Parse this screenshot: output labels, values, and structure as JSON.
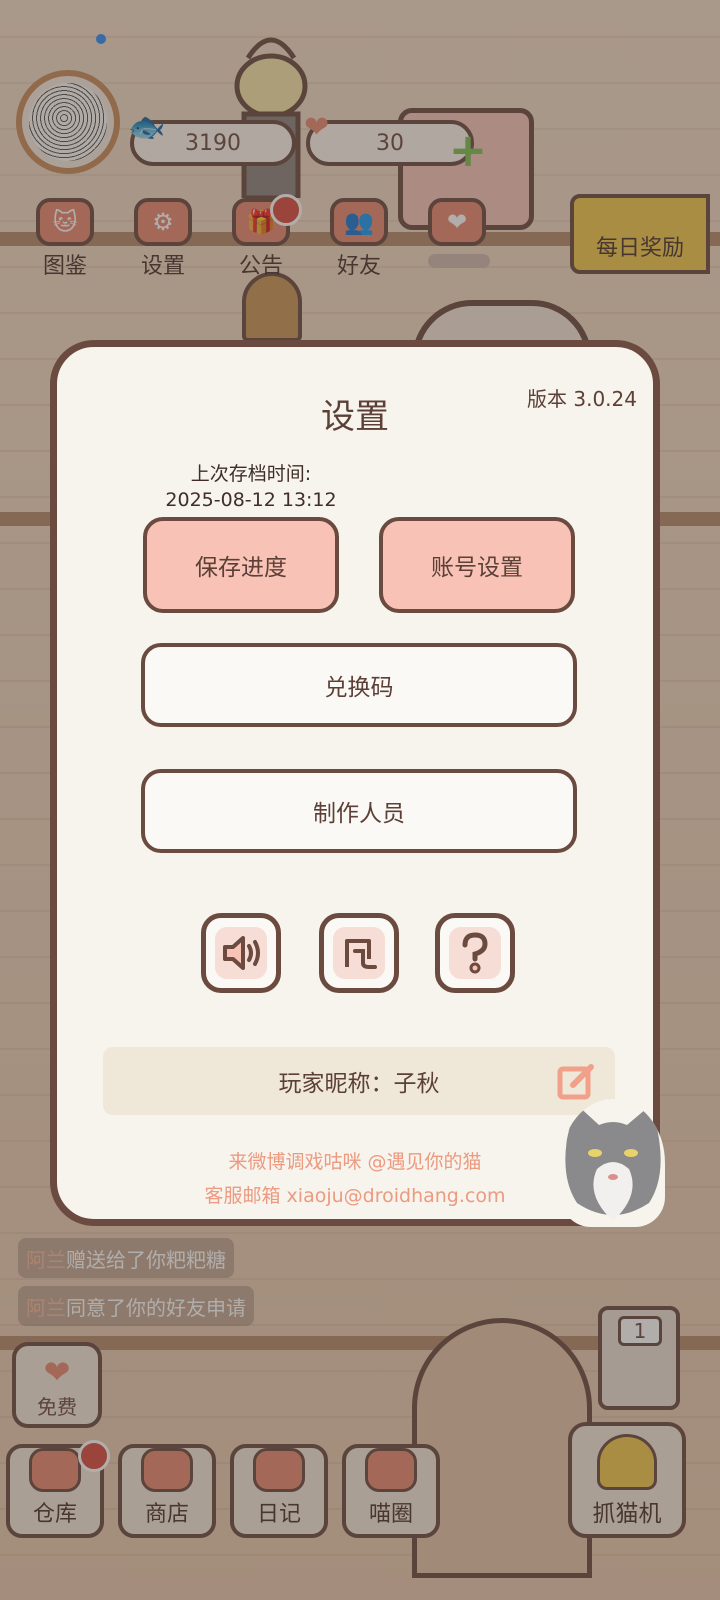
{
  "topbar": {
    "fish_count": "3190",
    "heart_count": "30"
  },
  "nav": [
    {
      "label": "图鉴",
      "icon": "cat-book-icon"
    },
    {
      "label": "设置",
      "icon": "gear-icon"
    },
    {
      "label": "公告",
      "icon": "gift-icon"
    },
    {
      "label": "好友",
      "icon": "friends-icon"
    },
    {
      "label": "",
      "icon": "heart-pair-icon"
    }
  ],
  "daily_reward": "每日奖励",
  "chat": [
    {
      "who": "阿兰",
      "text": "赠送给了你粑粑糖"
    },
    {
      "who": "阿兰",
      "text": "同意了你的好友申请"
    }
  ],
  "free_label": "免费",
  "bottom_menu": [
    {
      "label": "仓库"
    },
    {
      "label": "商店"
    },
    {
      "label": "日记"
    },
    {
      "label": "喵圈"
    }
  ],
  "claw_machine": {
    "label": "抓猫机",
    "count": "1"
  },
  "modal": {
    "title": "设置",
    "version": "版本 3.0.24",
    "save_time_label": "上次存档时间:",
    "save_time_value": "2025-08-12 13:12",
    "save_button": "保存进度",
    "account_button": "账号设置",
    "redeem_button": "兑换码",
    "credits_button": "制作人员",
    "icon_buttons": [
      "sound-icon",
      "music-icon",
      "help-icon"
    ],
    "nickname": "玩家昵称：子秋",
    "footer_weibo": "来微博调戏咕咪 @遇见你的猫",
    "footer_email": "客服邮箱 xiaoju@droidhang.com"
  },
  "colors": {
    "accent_pink": "#f8c3b6",
    "outline_brown": "#6b4a3f",
    "footer_text": "#ec9a80",
    "badge_red": "#d94a3f"
  }
}
